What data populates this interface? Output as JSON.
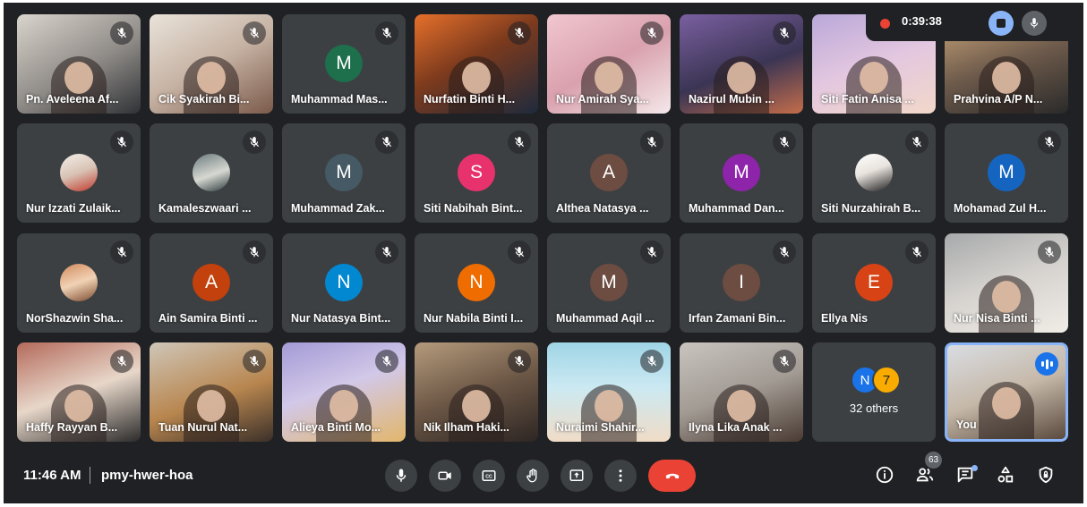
{
  "recording": {
    "timer": "0:39:38",
    "stop_icon": "stop-recording-icon",
    "mic_icon": "mic-icon"
  },
  "participants": [
    {
      "name": "Pn. Aveleena Af...",
      "mic": "muted"
    },
    {
      "name": "Cik Syakirah Bi...",
      "mic": "muted"
    },
    {
      "name": "Muhammad Mas...",
      "mic": "muted",
      "initial": "M",
      "color": "#1e6f4c"
    },
    {
      "name": "Nurfatin Binti H...",
      "mic": "muted"
    },
    {
      "name": "Nur Amirah Sya...",
      "mic": "muted"
    },
    {
      "name": "Nazirul Mubin ...",
      "mic": "muted"
    },
    {
      "name": "Siti Fatin Anisa ...",
      "mic": "muted"
    },
    {
      "name": "Prahvina A/P N...",
      "mic": "muted"
    },
    {
      "name": "Nur Izzati Zulaik...",
      "mic": "muted"
    },
    {
      "name": "Kamaleszwaari ...",
      "mic": "muted"
    },
    {
      "name": "Muhammad Zak...",
      "mic": "muted",
      "initial": "M",
      "color": "#455a64"
    },
    {
      "name": "Siti Nabihah Bint...",
      "mic": "muted",
      "initial": "S",
      "color": "#e8326e"
    },
    {
      "name": "Althea Natasya ...",
      "mic": "muted",
      "initial": "A",
      "color": "#6d4c41"
    },
    {
      "name": "Muhammad Dan...",
      "mic": "muted",
      "initial": "M",
      "color": "#8e24aa"
    },
    {
      "name": "Siti Nurzahirah B...",
      "mic": "muted"
    },
    {
      "name": "Mohamad Zul H...",
      "mic": "muted",
      "initial": "M",
      "color": "#1565c0"
    },
    {
      "name": "NorShazwin Sha...",
      "mic": "muted"
    },
    {
      "name": "Ain Samira Binti ...",
      "mic": "muted",
      "initial": "A",
      "color": "#c2410c"
    },
    {
      "name": "Nur Natasya Bint...",
      "mic": "muted",
      "initial": "N",
      "color": "#0288d1"
    },
    {
      "name": "Nur Nabila Binti I...",
      "mic": "muted",
      "initial": "N",
      "color": "#ef6c00"
    },
    {
      "name": "Muhammad Aqil ...",
      "mic": "muted",
      "initial": "M",
      "color": "#6d4c41"
    },
    {
      "name": "Irfan Zamani Bin...",
      "mic": "muted",
      "initial": "I",
      "color": "#6d4c41"
    },
    {
      "name": "Ellya Nis",
      "mic": "muted",
      "initial": "E",
      "color": "#d84315"
    },
    {
      "name": "Nur Nisa Binti ...",
      "mic": "muted"
    },
    {
      "name": "Haffy Rayyan B...",
      "mic": "muted"
    },
    {
      "name": "Tuan Nurul Nat...",
      "mic": "muted"
    },
    {
      "name": "Alieya Binti Mo...",
      "mic": "muted"
    },
    {
      "name": "Nik Ilham Haki...",
      "mic": "muted"
    },
    {
      "name": "Nuraimi Shahir...",
      "mic": "muted"
    },
    {
      "name": "Ilyna Lika Anak ...",
      "mic": "muted"
    }
  ],
  "others": {
    "label": "32 others",
    "initials": [
      "N",
      "7"
    ],
    "colors": [
      "#1a73e8",
      "#f9ab00"
    ]
  },
  "self": {
    "name": "You",
    "status": "speaking"
  },
  "bottom": {
    "time": "11:46 AM",
    "meeting_code": "pmy-hwer-hoa",
    "controls": [
      "mic-button",
      "camera-button",
      "captions-button",
      "raise-hand-button",
      "present-button",
      "more-options-button",
      "leave-call-button"
    ],
    "participant_count": "63",
    "end_color": "#ea4335"
  }
}
